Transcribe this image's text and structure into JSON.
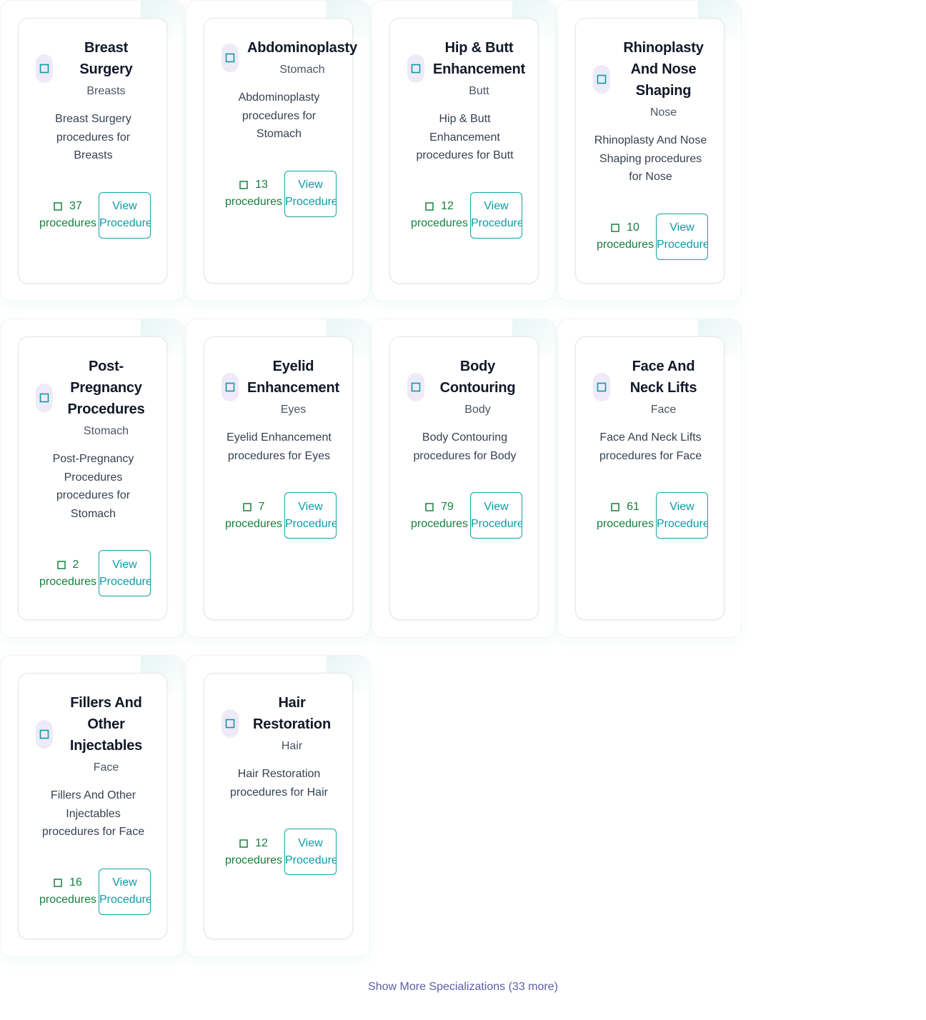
{
  "colors": {
    "accent": "#0e9aa7",
    "count": "#15803d",
    "icon_bg": "#efeaf7",
    "link": "#5b5ea6"
  },
  "cards": [
    {
      "title": [
        "Breast",
        "Surgery"
      ],
      "category": "Breasts",
      "desc": [
        "Breast Surgery",
        "procedures for",
        "Breasts"
      ],
      "count": "37",
      "count_label": "procedures",
      "btn": [
        "View",
        "Procedures"
      ],
      "icon": "square-icon"
    },
    {
      "title": [
        "Abdominoplasty"
      ],
      "category": "Stomach",
      "desc": [
        "Abdominoplasty",
        "procedures for",
        "Stomach"
      ],
      "count": "13",
      "count_label": "procedures",
      "btn": [
        "View",
        "Procedures"
      ],
      "icon": "square-icon"
    },
    {
      "title": [
        "Hip & Butt",
        "Enhancement"
      ],
      "category": "Butt",
      "desc": [
        "Hip & Butt",
        "Enhancement",
        "procedures for Butt"
      ],
      "count": "12",
      "count_label": "procedures",
      "btn": [
        "View",
        "Procedures"
      ],
      "icon": "square-icon"
    },
    {
      "title": [
        "Rhinoplasty",
        "And Nose",
        "Shaping"
      ],
      "category": "Nose",
      "desc": [
        "Rhinoplasty And Nose",
        "Shaping procedures",
        "for Nose"
      ],
      "count": "10",
      "count_label": "procedures",
      "btn": [
        "View",
        "Procedures"
      ],
      "icon": "square-icon"
    },
    {
      "title": [
        "Post-",
        "Pregnancy",
        "Procedures"
      ],
      "category": "Stomach",
      "desc": [
        "Post-Pregnancy",
        "Procedures",
        "procedures for",
        "Stomach"
      ],
      "count": "2",
      "count_label": "procedures",
      "btn": [
        "View",
        "Procedures"
      ],
      "icon": "square-icon"
    },
    {
      "title": [
        "Eyelid",
        "Enhancement"
      ],
      "category": "Eyes",
      "desc": [
        "Eyelid Enhancement",
        "procedures for Eyes"
      ],
      "count": "7",
      "count_label": "procedures",
      "btn": [
        "View",
        "Procedures"
      ],
      "icon": "square-icon"
    },
    {
      "title": [
        "Body",
        "Contouring"
      ],
      "category": "Body",
      "desc": [
        "Body Contouring",
        "procedures for Body"
      ],
      "count": "79",
      "count_label": "procedures",
      "btn": [
        "View",
        "Procedures"
      ],
      "icon": "square-icon"
    },
    {
      "title": [
        "Face And",
        "Neck Lifts"
      ],
      "category": "Face",
      "desc": [
        "Face And Neck Lifts",
        "procedures for Face"
      ],
      "count": "61",
      "count_label": "procedures",
      "btn": [
        "View",
        "Procedures"
      ],
      "icon": "square-icon"
    },
    {
      "title": [
        "Fillers And",
        "Other",
        "Injectables"
      ],
      "category": "Face",
      "desc": [
        "Fillers And Other",
        "Injectables",
        "procedures for Face"
      ],
      "count": "16",
      "count_label": "procedures",
      "btn": [
        "View",
        "Procedures"
      ],
      "icon": "square-icon"
    },
    {
      "title": [
        "Hair",
        "Restoration"
      ],
      "category": "Hair",
      "desc": [
        "Hair Restoration",
        "procedures for Hair"
      ],
      "count": "12",
      "count_label": "procedures",
      "btn": [
        "View",
        "Procedures"
      ],
      "icon": "square-icon"
    }
  ],
  "show_more": "Show More Specializations (33 more)"
}
